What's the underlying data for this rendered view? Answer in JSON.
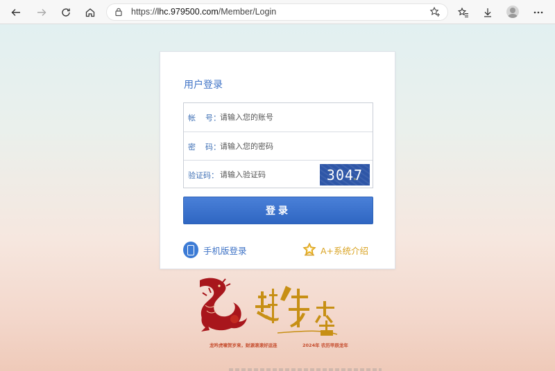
{
  "browser": {
    "url_prefix": "https://",
    "url_host": "lhc.979500.com",
    "url_path": "/Member/Login"
  },
  "login": {
    "title": "用户登录",
    "account_label": "帐    号：",
    "account_placeholder": "请输入您的账号",
    "password_label": "密    码：",
    "password_placeholder": "请输入您的密码",
    "captcha_label": "验证码：",
    "captcha_placeholder": "请输入验证码",
    "captcha_code": "3047",
    "submit_label": "登录",
    "mobile_link": "手机版登录",
    "system_link": "A+系统介绍"
  },
  "banner": {
    "slogan_left": "龙吟虎啸贺岁来，财源滚滚好运连",
    "slogan_right": "2024年 农历甲辰龙年"
  }
}
